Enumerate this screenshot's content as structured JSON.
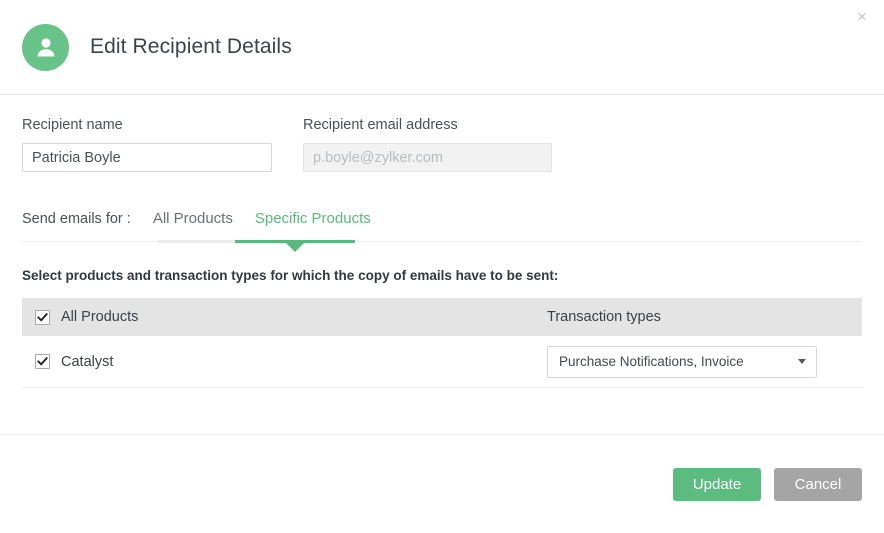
{
  "dialog": {
    "title": "Edit Recipient Details",
    "close_label": "×",
    "avatar_icon": "user-avatar-icon",
    "accent_color": "#5ab87c",
    "header_band_color": "#e4e4e4"
  },
  "form": {
    "name_field": {
      "label": "Recipient name",
      "value": "Patricia Boyle",
      "placeholder": ""
    },
    "email_field": {
      "label": "Recipient email address",
      "value": "",
      "placeholder": "p.boyle@zylker.com",
      "disabled": true
    }
  },
  "tabs": {
    "caption": "Send emails for :",
    "items": [
      {
        "label": "All Products",
        "active": false
      },
      {
        "label": "Specific Products",
        "active": true
      }
    ]
  },
  "products_section": {
    "instruction": "Select products and transaction types for which the copy of emails have to be sent:",
    "header": {
      "select_all_label": "All Products",
      "select_all_checked": true,
      "transaction_types_label": "Transaction types"
    },
    "rows": [
      {
        "name": "Catalyst",
        "checked": true,
        "transaction_types": "Purchase Notifications, Invoice"
      }
    ]
  },
  "footer": {
    "update_label": "Update",
    "cancel_label": "Cancel"
  }
}
